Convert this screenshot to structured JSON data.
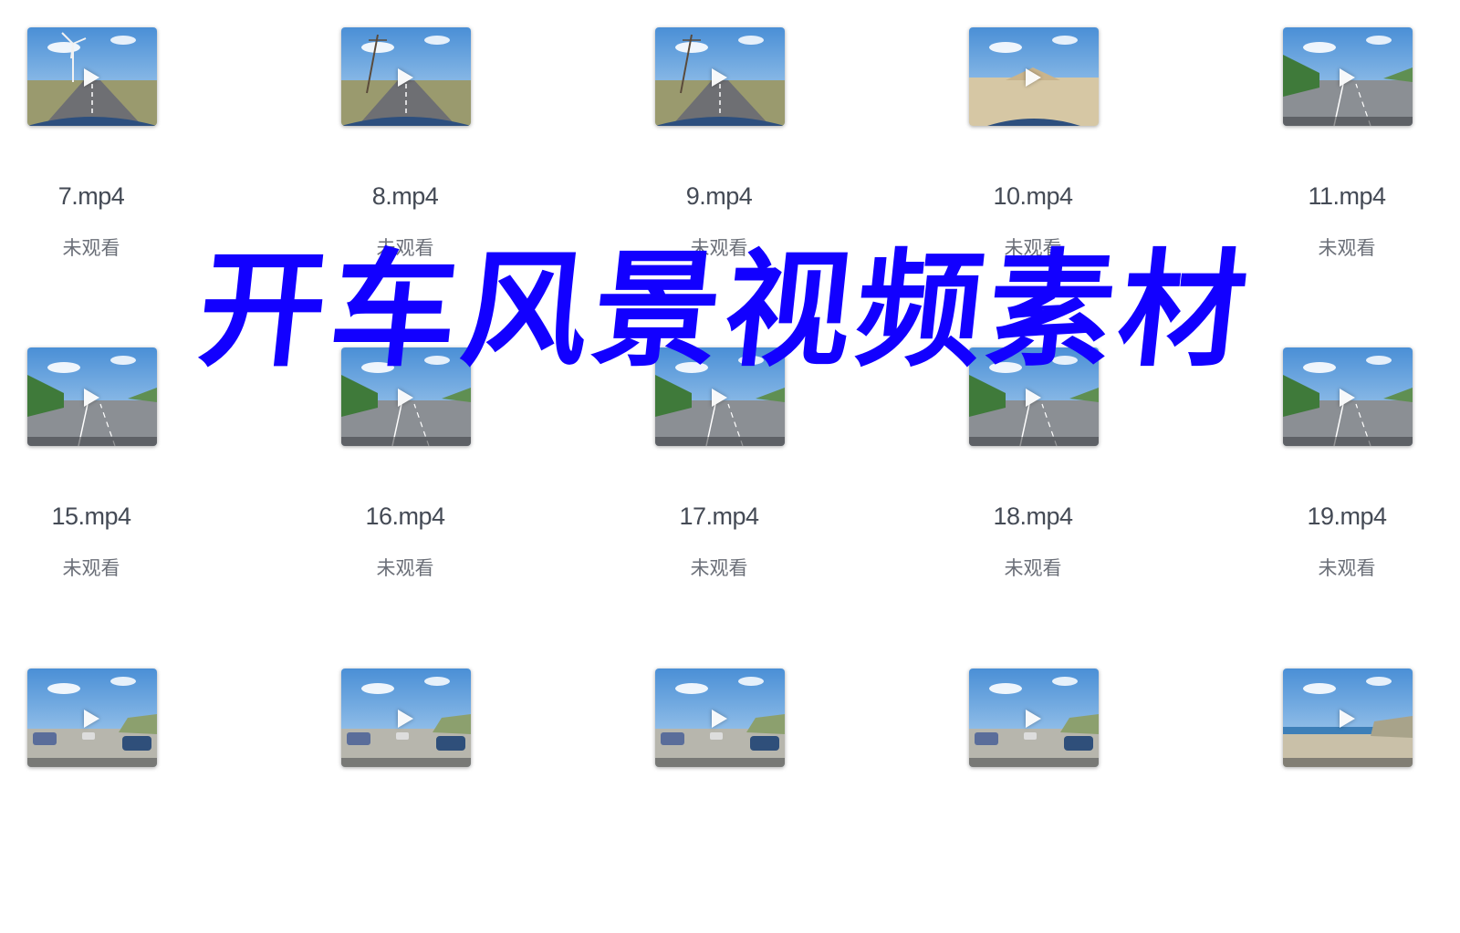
{
  "files": [
    {
      "name": "7.mp4",
      "status": "未观看",
      "scene": "windmill"
    },
    {
      "name": "8.mp4",
      "status": "未观看",
      "scene": "pole"
    },
    {
      "name": "9.mp4",
      "status": "未观看",
      "scene": "pole"
    },
    {
      "name": "10.mp4",
      "status": "未观看",
      "scene": "sand"
    },
    {
      "name": "11.mp4",
      "status": "未观看",
      "scene": "highway"
    },
    {
      "name": "15.mp4",
      "status": "未观看",
      "scene": "highway"
    },
    {
      "name": "16.mp4",
      "status": "未观看",
      "scene": "highway"
    },
    {
      "name": "17.mp4",
      "status": "未观看",
      "scene": "highway"
    },
    {
      "name": "18.mp4",
      "status": "未观看",
      "scene": "highway"
    },
    {
      "name": "19.mp4",
      "status": "未观看",
      "scene": "highway"
    },
    {
      "name": "",
      "status": "",
      "scene": "parking"
    },
    {
      "name": "",
      "status": "",
      "scene": "parking"
    },
    {
      "name": "",
      "status": "",
      "scene": "parking"
    },
    {
      "name": "",
      "status": "",
      "scene": "parking"
    },
    {
      "name": "",
      "status": "",
      "scene": "beach"
    }
  ],
  "overlay": {
    "headline": "开车风景视频素材",
    "headline_color": "#1200ff"
  },
  "icons": {
    "play": "play-icon"
  }
}
